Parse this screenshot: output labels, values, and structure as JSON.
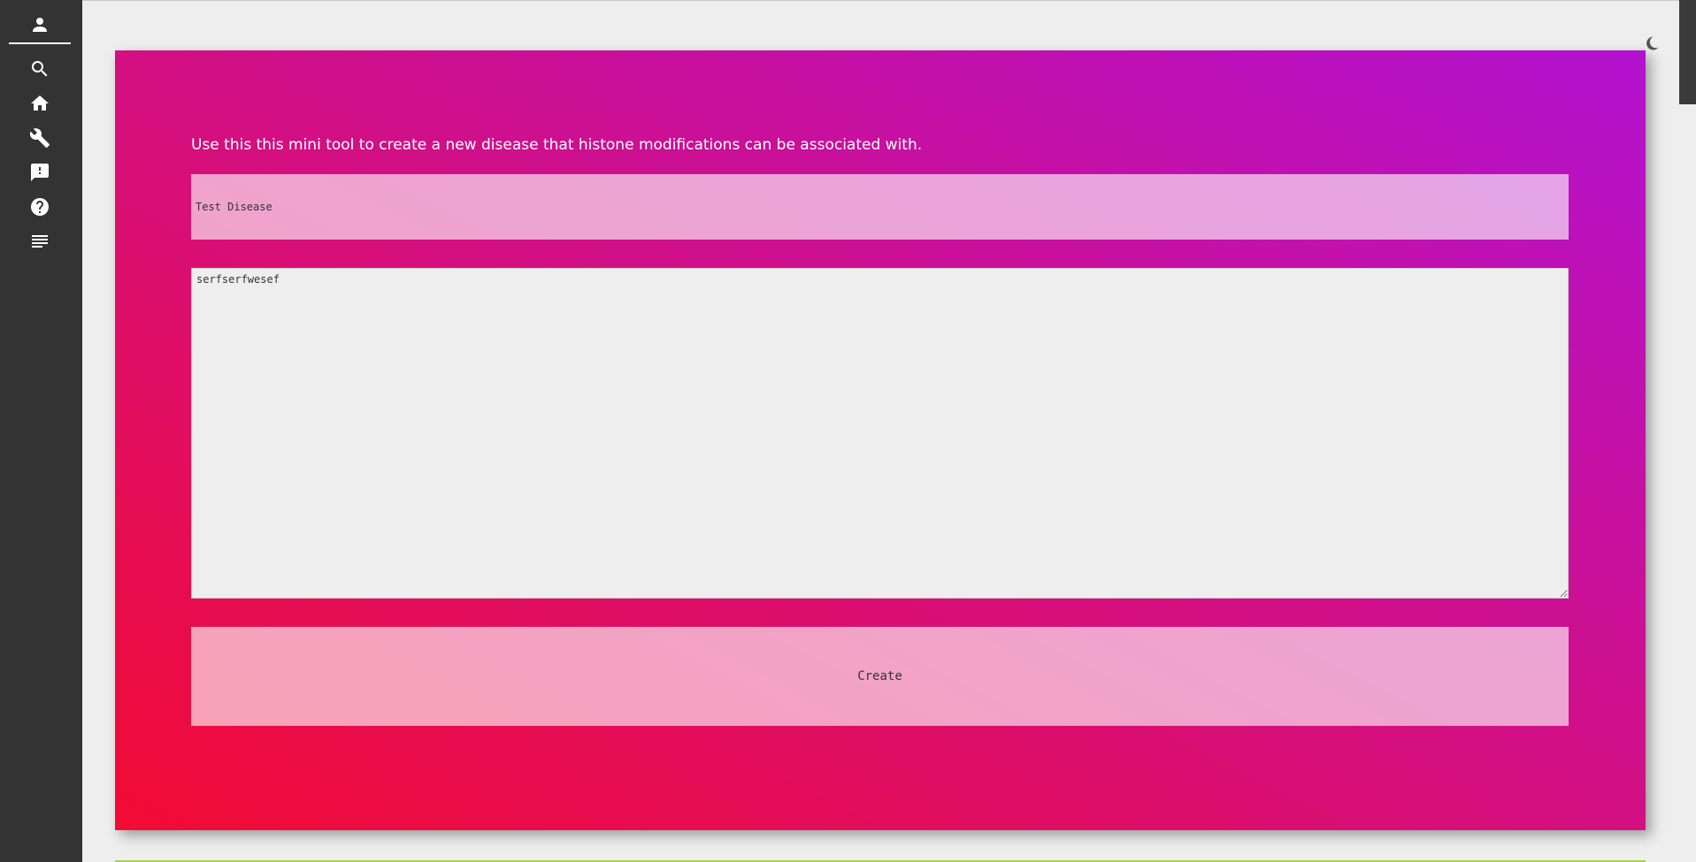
{
  "sidebar": {
    "icons": [
      "person-icon",
      "search-icon",
      "home-icon",
      "wrench-icon",
      "feedback-icon",
      "help-icon",
      "notes-icon"
    ]
  },
  "theme_toggle": {
    "icon": "moon-icon"
  },
  "form": {
    "intro": "Use this this mini tool to create a new disease that histone modifications can be associated with.",
    "name_value": "Test Disease",
    "description_value": "serfserfwesef",
    "create_label": "Create"
  },
  "colors": {
    "gradient_start": "#f20b33",
    "gradient_mid": "#d60f7a",
    "gradient_end": "#b312d0",
    "sidebar": "#333333",
    "background": "#eeeeee"
  }
}
